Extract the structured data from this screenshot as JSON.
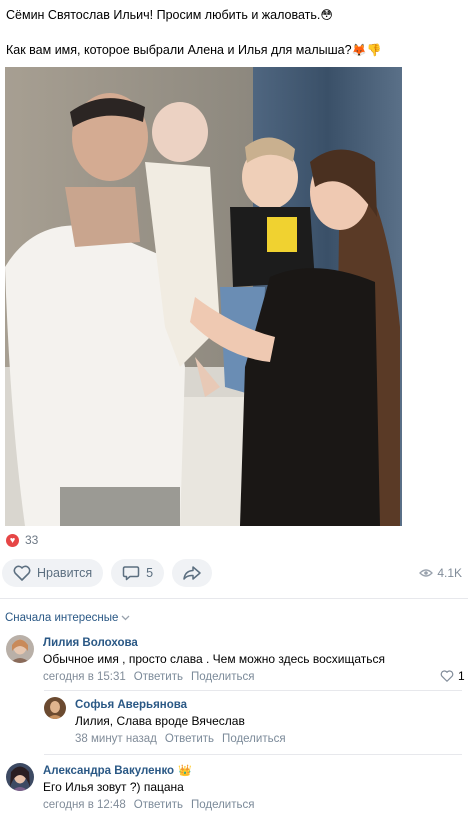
{
  "post": {
    "text_line1": "Сёмин Святослав Ильич! Просим любить и жаловать.",
    "text_line2": "Как вам имя, которое выбрали Алена и Илья для малыша?",
    "likes_count": "33",
    "like_button_label": "Нравится",
    "comments_count": "5",
    "views_count": "4.1K"
  },
  "comments": {
    "sort_label": "Сначала интересные",
    "items": [
      {
        "author": "Лилия Волохова",
        "text": "Обычное имя , просто слава . Чем можно здесь восхищаться",
        "time": "сегодня в 15:31",
        "reply_label": "Ответить",
        "share_label": "Поделиться",
        "likes": "1"
      },
      {
        "author": "Софья Аверьянова",
        "text": "Лилия, Слава вроде Вячеслав",
        "time": "38 минут назад",
        "reply_label": "Ответить",
        "share_label": "Поделиться"
      },
      {
        "author": "Александра Вакуленко",
        "text": "Его Илья зовут ?) пацана",
        "time": "сегодня в 12:48",
        "reply_label": "Ответить",
        "share_label": "Поделиться"
      }
    ]
  },
  "colors": {
    "link": "#2a5885",
    "accent_red": "#e64646",
    "muted": "#818c99",
    "pill_bg": "#f0f2f5"
  },
  "icons": [
    "astonished-emoji",
    "fox-emoji",
    "thumb-down-emoji",
    "heart-icon",
    "comment-icon",
    "share-icon",
    "eye-icon",
    "chevron-down-icon",
    "crown-emoji"
  ]
}
